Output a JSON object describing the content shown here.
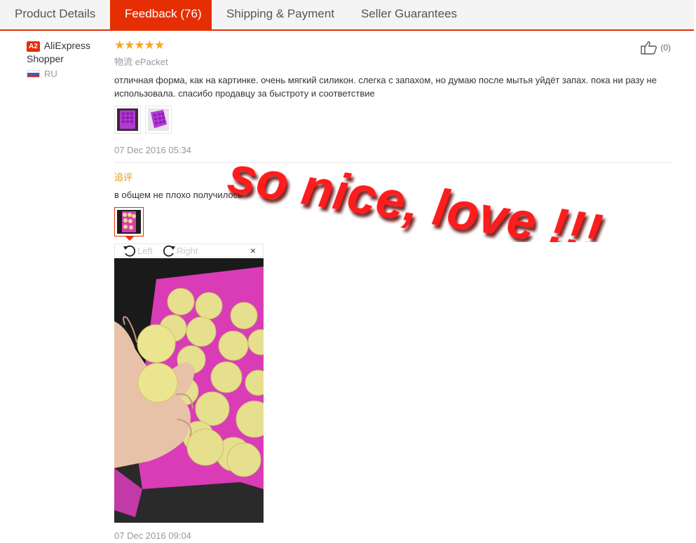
{
  "tabs": [
    {
      "label": "Product Details",
      "active": false
    },
    {
      "label": "Feedback (76)",
      "active": true
    },
    {
      "label": "Shipping & Payment",
      "active": false
    },
    {
      "label": "Seller Guarantees",
      "active": false
    }
  ],
  "user": {
    "level_badge": "A2",
    "name_line1": "AliExpress",
    "name_line2": "Shopper",
    "country": "RU"
  },
  "feedback": {
    "rating": 5,
    "stars": "★★★★★",
    "logistics_label": "物流",
    "logistics_value": "ePacket",
    "text": "отличная форма, как на картинке. очень мягкий силикон. слегка с запахом, но думаю после мытья уйдёт запах. пока ни разу не использовала. спасибо продавцу за быстроту и соответствие",
    "date": "07 Dec 2016 05:34",
    "helpful_count": "(0)"
  },
  "followup": {
    "label": "追评",
    "text": "в общем не плохо получилось",
    "date": "07 Dec 2016 09:04"
  },
  "viewer": {
    "rotate_left": "Left",
    "rotate_right": "Right",
    "close": "×"
  },
  "overlay": {
    "text": "so nice, love !!!",
    "color": "#ff1a1a"
  },
  "colors": {
    "accent": "#e62e04",
    "star": "#f5a623",
    "followup": "#f39800",
    "photo_tray": "#d83ab8"
  }
}
